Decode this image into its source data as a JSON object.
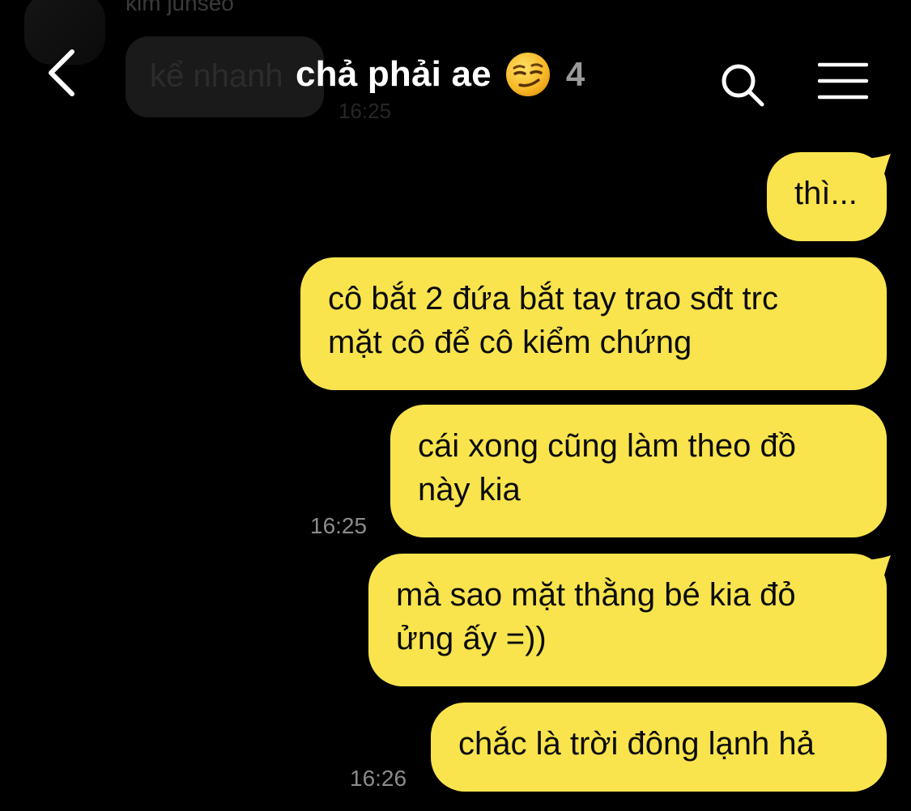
{
  "background_message": {
    "sender": "kim junseo",
    "text": "kể nhanh",
    "time": "16:25"
  },
  "header": {
    "title": "chả phải ae",
    "title_emoji": "smirking-face-emoji",
    "member_count": "4",
    "icons": [
      "back-icon",
      "search-icon",
      "menu-icon"
    ]
  },
  "messages": [
    {
      "lines": [
        "thì..."
      ]
    },
    {
      "lines": [
        "cô bắt 2 đứa bắt tay trao sđt trc",
        "mặt cô để cô kiểm chứng"
      ]
    },
    {
      "lines": [
        "cái xong cũng làm theo đồ",
        "này kia"
      ],
      "time": "16:25"
    },
    {
      "lines": [
        "mà sao mặt thằng bé kia đỏ",
        "ửng ấy =))"
      ]
    },
    {
      "lines": [
        "chắc là trời đông lạnh hả"
      ],
      "time": "16:26"
    }
  ],
  "colors": {
    "background": "#000000",
    "bubble": "#f9e44d",
    "bubble_text": "#0b0b0b",
    "timestamp": "#8b8b8b",
    "member_count": "#9a9a9a"
  }
}
